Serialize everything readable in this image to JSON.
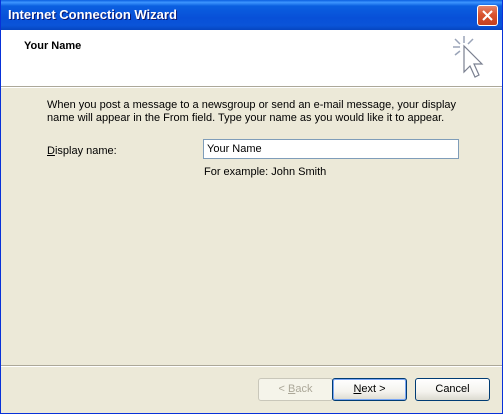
{
  "window": {
    "title": "Internet Connection Wizard"
  },
  "header": {
    "title": "Your Name"
  },
  "body": {
    "description": "When you post a message to a newsgroup or send an e-mail message, your display name will appear in the From field.  Type your name as you would like it to appear.",
    "display_name_label_prefix": "D",
    "display_name_label_rest": "isplay name:",
    "display_name_value": "Your Name",
    "example": "For example: John Smith"
  },
  "buttons": {
    "back_prefix": "< ",
    "back_mnemonic": "B",
    "back_rest": "ack",
    "next_mnemonic": "N",
    "next_rest": "ext >",
    "cancel": "Cancel"
  }
}
